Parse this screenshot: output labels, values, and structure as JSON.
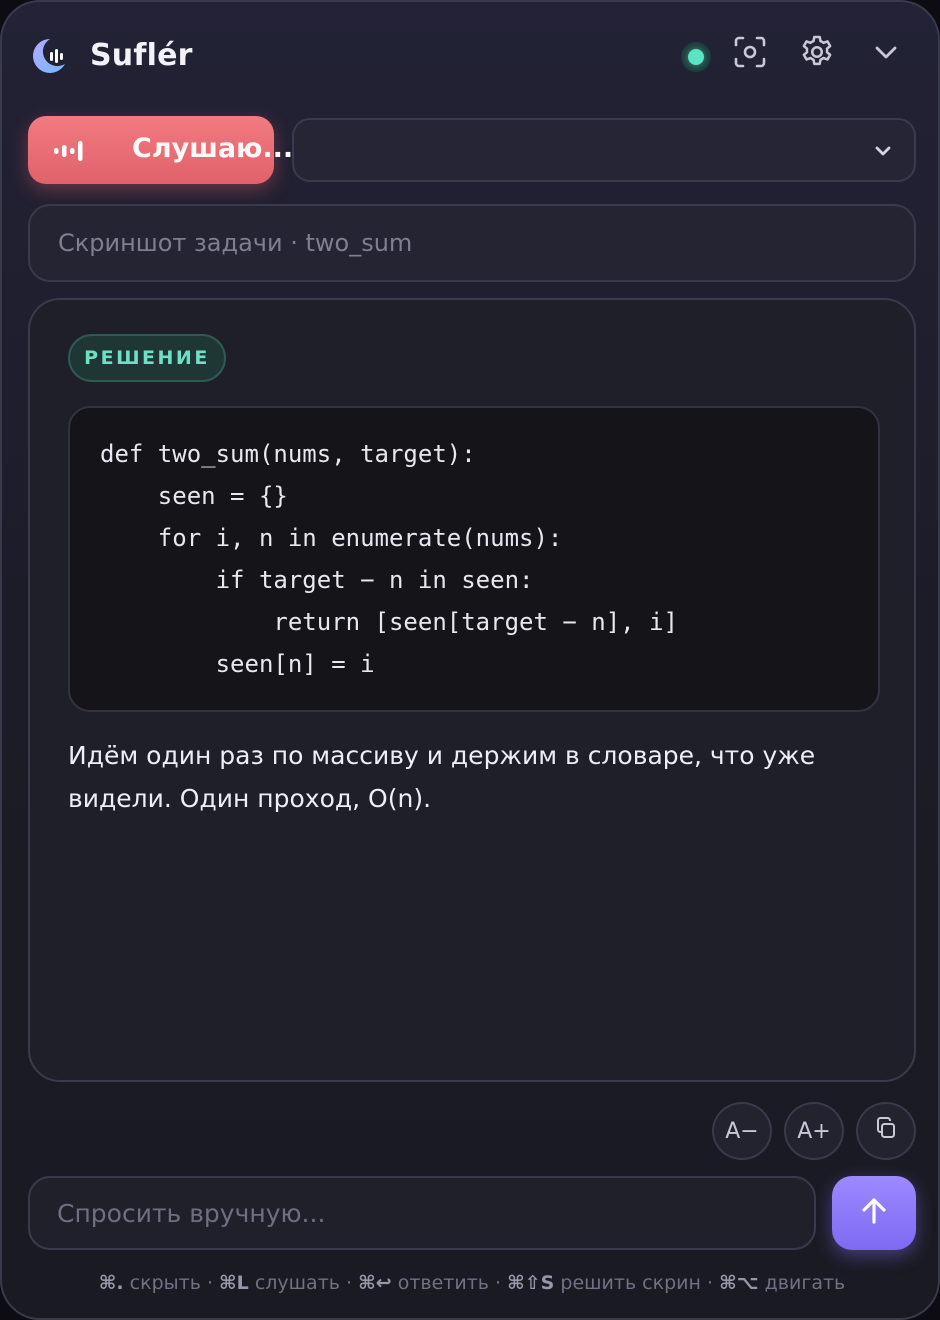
{
  "header": {
    "title": "Suflér",
    "status_color": "#5be3c6",
    "icons": [
      "moon-wave-logo-icon",
      "screenshot-icon",
      "gear-icon",
      "chevron-down-icon"
    ]
  },
  "listen": {
    "label": "Слушаю...",
    "color": "#e9686f"
  },
  "select": {
    "value": ""
  },
  "context": {
    "text": "Скриншот задачи · two_sum"
  },
  "answer": {
    "badge": "РЕШЕНИЕ",
    "code_lines": [
      "def two_sum(nums, target):",
      "    seen = {}",
      "    for i, n in enumerate(nums):",
      "        if target − n in seen:",
      "            return [seen[target − n], i]",
      "        seen[n] = i"
    ],
    "explanation": "Идём один раз по массиву и держим в словаре, что уже видели. Один проход, O(n)."
  },
  "font_controls": {
    "decrease_label": "A−",
    "increase_label": "A+"
  },
  "ask": {
    "placeholder": "Спросить вручную...",
    "send_color": "#8a76f7"
  },
  "hints": [
    {
      "key": "⌘.",
      "label": "скрыть"
    },
    {
      "key": "⌘L",
      "label": "слушать"
    },
    {
      "key": "⌘↩",
      "label": "ответить"
    },
    {
      "key": "⌘⇧S",
      "label": "решить скрин"
    },
    {
      "key": "⌘⌥",
      "label": "двигать"
    }
  ]
}
